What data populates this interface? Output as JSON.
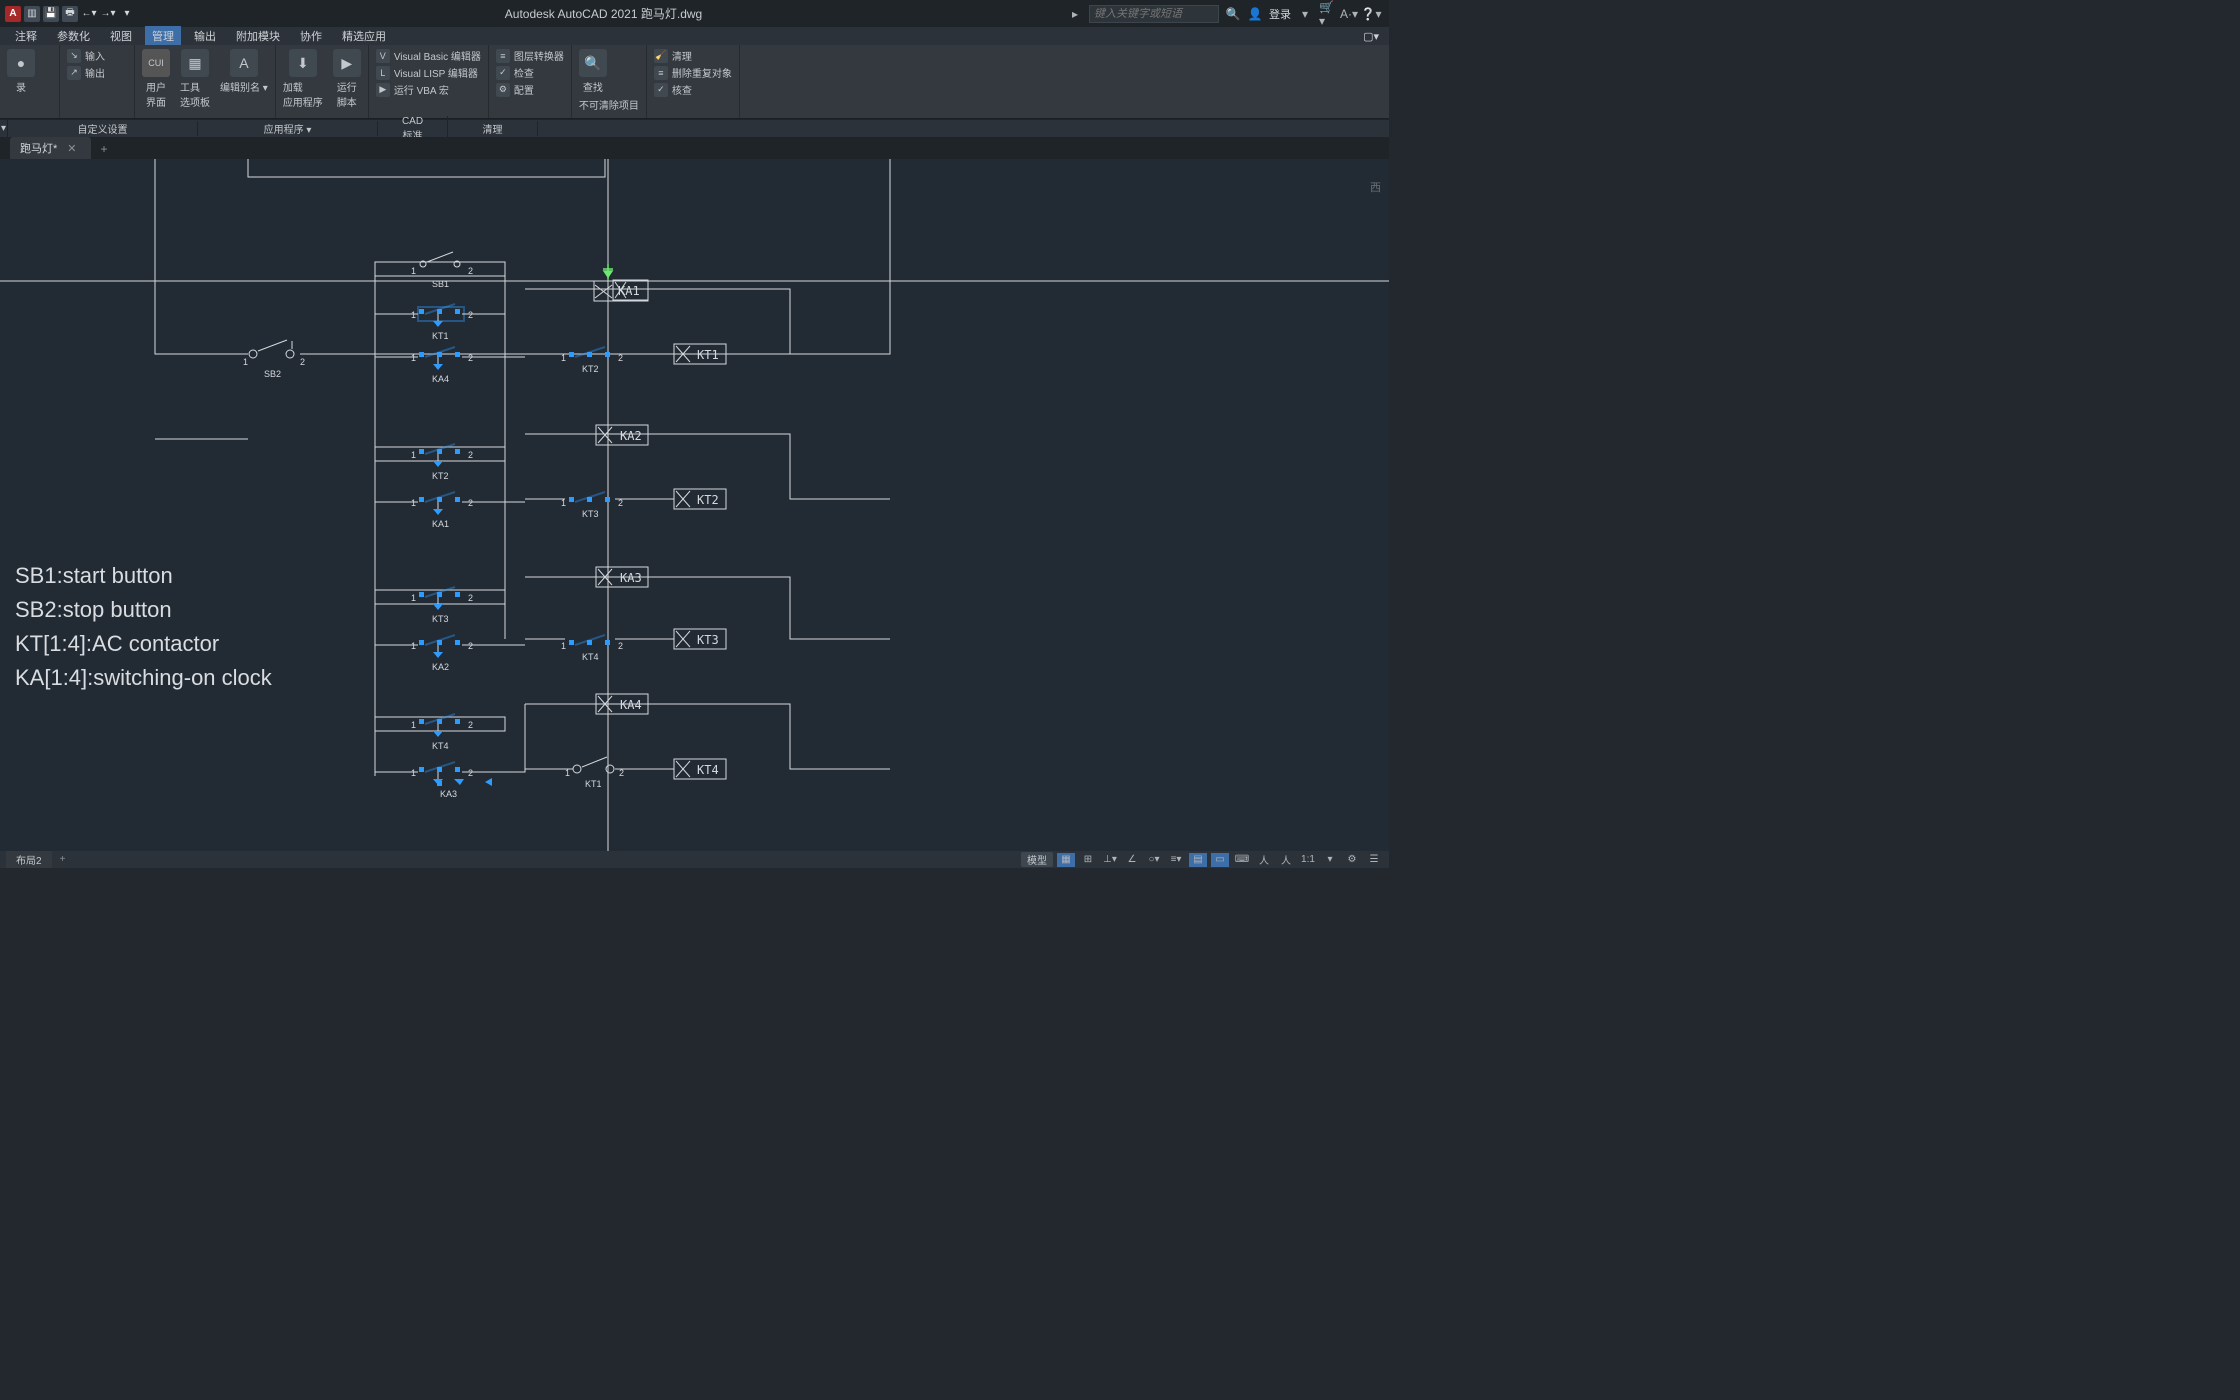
{
  "app": {
    "title": "Autodesk AutoCAD 2021   跑马灯.dwg"
  },
  "titlebar": {
    "search_ph": "键入关键字或短语",
    "login": "登录"
  },
  "menus": [
    "注释",
    "参数化",
    "视图",
    "管理",
    "输出",
    "附加模块",
    "协作",
    "精选应用"
  ],
  "active_menu": 3,
  "ribbon": {
    "col0_a": "录",
    "col0_b": "▾",
    "col1": [
      "输入",
      "输出"
    ],
    "col2": {
      "cui": "CUI",
      "user": "用户\n界面",
      "tools": "工具\n选项板",
      "alias": "编辑别名 ▾"
    },
    "col3": {
      "load": "加载\n应用程序",
      "run": "运行\n脚本"
    },
    "col4": [
      "Visual Basic 编辑器",
      "Visual LISP 编辑器",
      "运行 VBA 宏"
    ],
    "col5": [
      "图层转换器",
      "检查",
      "配置"
    ],
    "col6": {
      "find": "查找",
      "unpurge": "不可清除项目"
    },
    "col7": [
      "清理",
      "删除重复对象",
      "核查"
    ]
  },
  "panel_labels": [
    "自定义设置",
    "应用程序 ▾",
    "CAD 标准",
    "清理"
  ],
  "filetab": {
    "name": "跑马灯*",
    "add": "+"
  },
  "components": {
    "sb1": "SB1",
    "sb2": "SB2",
    "kt1": "KT1",
    "kt2": "KT2",
    "kt3": "KT3",
    "kt4": "KT4",
    "ka1": "KA1",
    "ka2": "KA2",
    "ka3": "KA3",
    "ka4": "KA4",
    "pin1": "1",
    "pin2": "2",
    "kt1s": "KT1",
    "kt2s": "KT2",
    "kt3s": "KT3",
    "kt4s": "KT4",
    "ka1s": "KA1",
    "ka2s": "KA2",
    "ka3s": "KA3",
    "ka4s": "KA4"
  },
  "legend": {
    "l1": "SB1:start button",
    "l2": "SB2:stop button",
    "l3": "KT[1:4]:AC contactor",
    "l4": "KA[1:4]:switching-on clock"
  },
  "nav": {
    "label": "西"
  },
  "layout": {
    "tab": "布局2"
  },
  "status": {
    "model": "模型",
    "scale": "1:1"
  }
}
